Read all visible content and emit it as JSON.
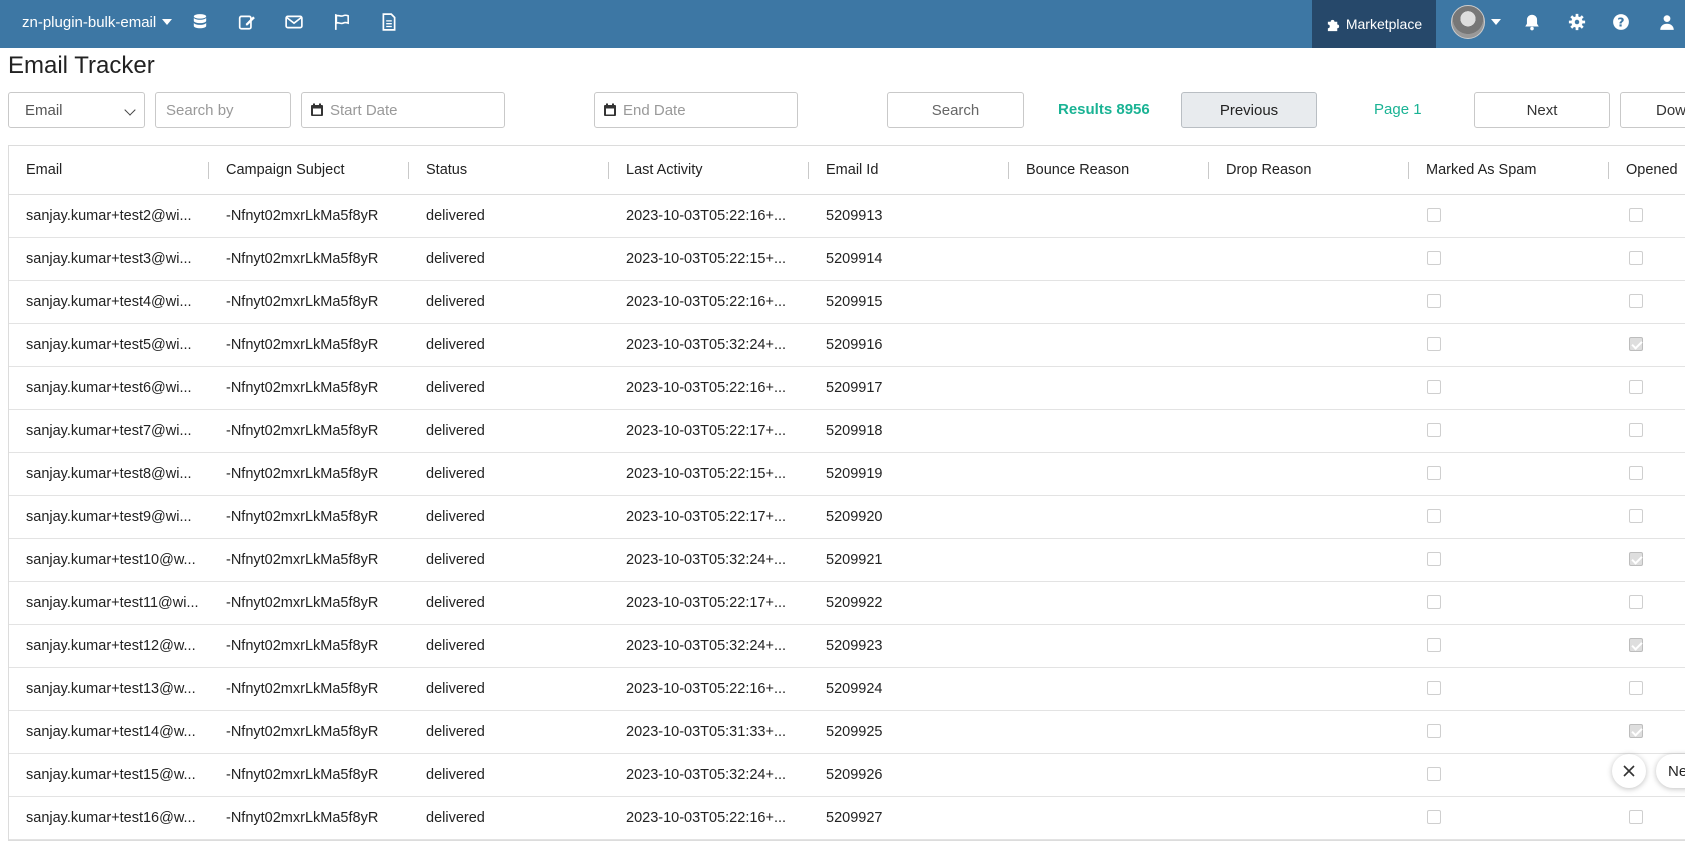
{
  "topbar": {
    "app_name": "zn-plugin-bulk-email",
    "icons": [
      "database-icon",
      "edit-icon",
      "envelope-icon",
      "flag-icon",
      "document-icon"
    ],
    "marketplace_label": "Marketplace",
    "right_icons": [
      "bell-icon",
      "gear-icon",
      "help-icon",
      "user-group-icon"
    ],
    "bg_color": "#3d77a4",
    "marketplace_bg": "#26486a"
  },
  "page": {
    "title": "Email Tracker"
  },
  "filters": {
    "field_select": "Email",
    "search_placeholder": "Search by",
    "start_date_placeholder": "Start Date",
    "end_date_placeholder": "End Date",
    "search_label": "Search",
    "results_label": "Results 8956",
    "previous_label": "Previous",
    "page_label": "Page 1",
    "next_label": "Next",
    "download_label": "Dow",
    "accent_color": "#1ab394"
  },
  "table": {
    "columns": [
      "Email",
      "Campaign Subject",
      "Status",
      "Last Activity",
      "Email Id",
      "Bounce Reason",
      "Drop Reason",
      "Marked As Spam",
      "Opened"
    ],
    "rows": [
      {
        "email": "sanjay.kumar+test2@wi...",
        "subject": "-Nfnyt02mxrLkMa5f8yR",
        "status": "delivered",
        "last_activity": "2023-10-03T05:22:16+...",
        "email_id": "5209913",
        "bounce": "",
        "drop": "",
        "spam": false,
        "opened": false
      },
      {
        "email": "sanjay.kumar+test3@wi...",
        "subject": "-Nfnyt02mxrLkMa5f8yR",
        "status": "delivered",
        "last_activity": "2023-10-03T05:22:15+...",
        "email_id": "5209914",
        "bounce": "",
        "drop": "",
        "spam": false,
        "opened": false
      },
      {
        "email": "sanjay.kumar+test4@wi...",
        "subject": "-Nfnyt02mxrLkMa5f8yR",
        "status": "delivered",
        "last_activity": "2023-10-03T05:22:16+...",
        "email_id": "5209915",
        "bounce": "",
        "drop": "",
        "spam": false,
        "opened": false
      },
      {
        "email": "sanjay.kumar+test5@wi...",
        "subject": "-Nfnyt02mxrLkMa5f8yR",
        "status": "delivered",
        "last_activity": "2023-10-03T05:32:24+...",
        "email_id": "5209916",
        "bounce": "",
        "drop": "",
        "spam": false,
        "opened": true
      },
      {
        "email": "sanjay.kumar+test6@wi...",
        "subject": "-Nfnyt02mxrLkMa5f8yR",
        "status": "delivered",
        "last_activity": "2023-10-03T05:22:16+...",
        "email_id": "5209917",
        "bounce": "",
        "drop": "",
        "spam": false,
        "opened": false
      },
      {
        "email": "sanjay.kumar+test7@wi...",
        "subject": "-Nfnyt02mxrLkMa5f8yR",
        "status": "delivered",
        "last_activity": "2023-10-03T05:22:17+...",
        "email_id": "5209918",
        "bounce": "",
        "drop": "",
        "spam": false,
        "opened": false
      },
      {
        "email": "sanjay.kumar+test8@wi...",
        "subject": "-Nfnyt02mxrLkMa5f8yR",
        "status": "delivered",
        "last_activity": "2023-10-03T05:22:15+...",
        "email_id": "5209919",
        "bounce": "",
        "drop": "",
        "spam": false,
        "opened": false
      },
      {
        "email": "sanjay.kumar+test9@wi...",
        "subject": "-Nfnyt02mxrLkMa5f8yR",
        "status": "delivered",
        "last_activity": "2023-10-03T05:22:17+...",
        "email_id": "5209920",
        "bounce": "",
        "drop": "",
        "spam": false,
        "opened": false
      },
      {
        "email": "sanjay.kumar+test10@w...",
        "subject": "-Nfnyt02mxrLkMa5f8yR",
        "status": "delivered",
        "last_activity": "2023-10-03T05:32:24+...",
        "email_id": "5209921",
        "bounce": "",
        "drop": "",
        "spam": false,
        "opened": true
      },
      {
        "email": "sanjay.kumar+test11@wi...",
        "subject": "-Nfnyt02mxrLkMa5f8yR",
        "status": "delivered",
        "last_activity": "2023-10-03T05:22:17+...",
        "email_id": "5209922",
        "bounce": "",
        "drop": "",
        "spam": false,
        "opened": false
      },
      {
        "email": "sanjay.kumar+test12@w...",
        "subject": "-Nfnyt02mxrLkMa5f8yR",
        "status": "delivered",
        "last_activity": "2023-10-03T05:32:24+...",
        "email_id": "5209923",
        "bounce": "",
        "drop": "",
        "spam": false,
        "opened": true
      },
      {
        "email": "sanjay.kumar+test13@w...",
        "subject": "-Nfnyt02mxrLkMa5f8yR",
        "status": "delivered",
        "last_activity": "2023-10-03T05:22:16+...",
        "email_id": "5209924",
        "bounce": "",
        "drop": "",
        "spam": false,
        "opened": false
      },
      {
        "email": "sanjay.kumar+test14@w...",
        "subject": "-Nfnyt02mxrLkMa5f8yR",
        "status": "delivered",
        "last_activity": "2023-10-03T05:31:33+...",
        "email_id": "5209925",
        "bounce": "",
        "drop": "",
        "spam": false,
        "opened": true
      },
      {
        "email": "sanjay.kumar+test15@w...",
        "subject": "-Nfnyt02mxrLkMa5f8yR",
        "status": "delivered",
        "last_activity": "2023-10-03T05:32:24+...",
        "email_id": "5209926",
        "bounce": "",
        "drop": "",
        "spam": false,
        "opened": false
      },
      {
        "email": "sanjay.kumar+test16@w...",
        "subject": "-Nfnyt02mxrLkMa5f8yR",
        "status": "delivered",
        "last_activity": "2023-10-03T05:22:16+...",
        "email_id": "5209927",
        "bounce": "",
        "drop": "",
        "spam": false,
        "opened": false
      }
    ]
  },
  "chat_widget": {
    "label": "Ne"
  }
}
